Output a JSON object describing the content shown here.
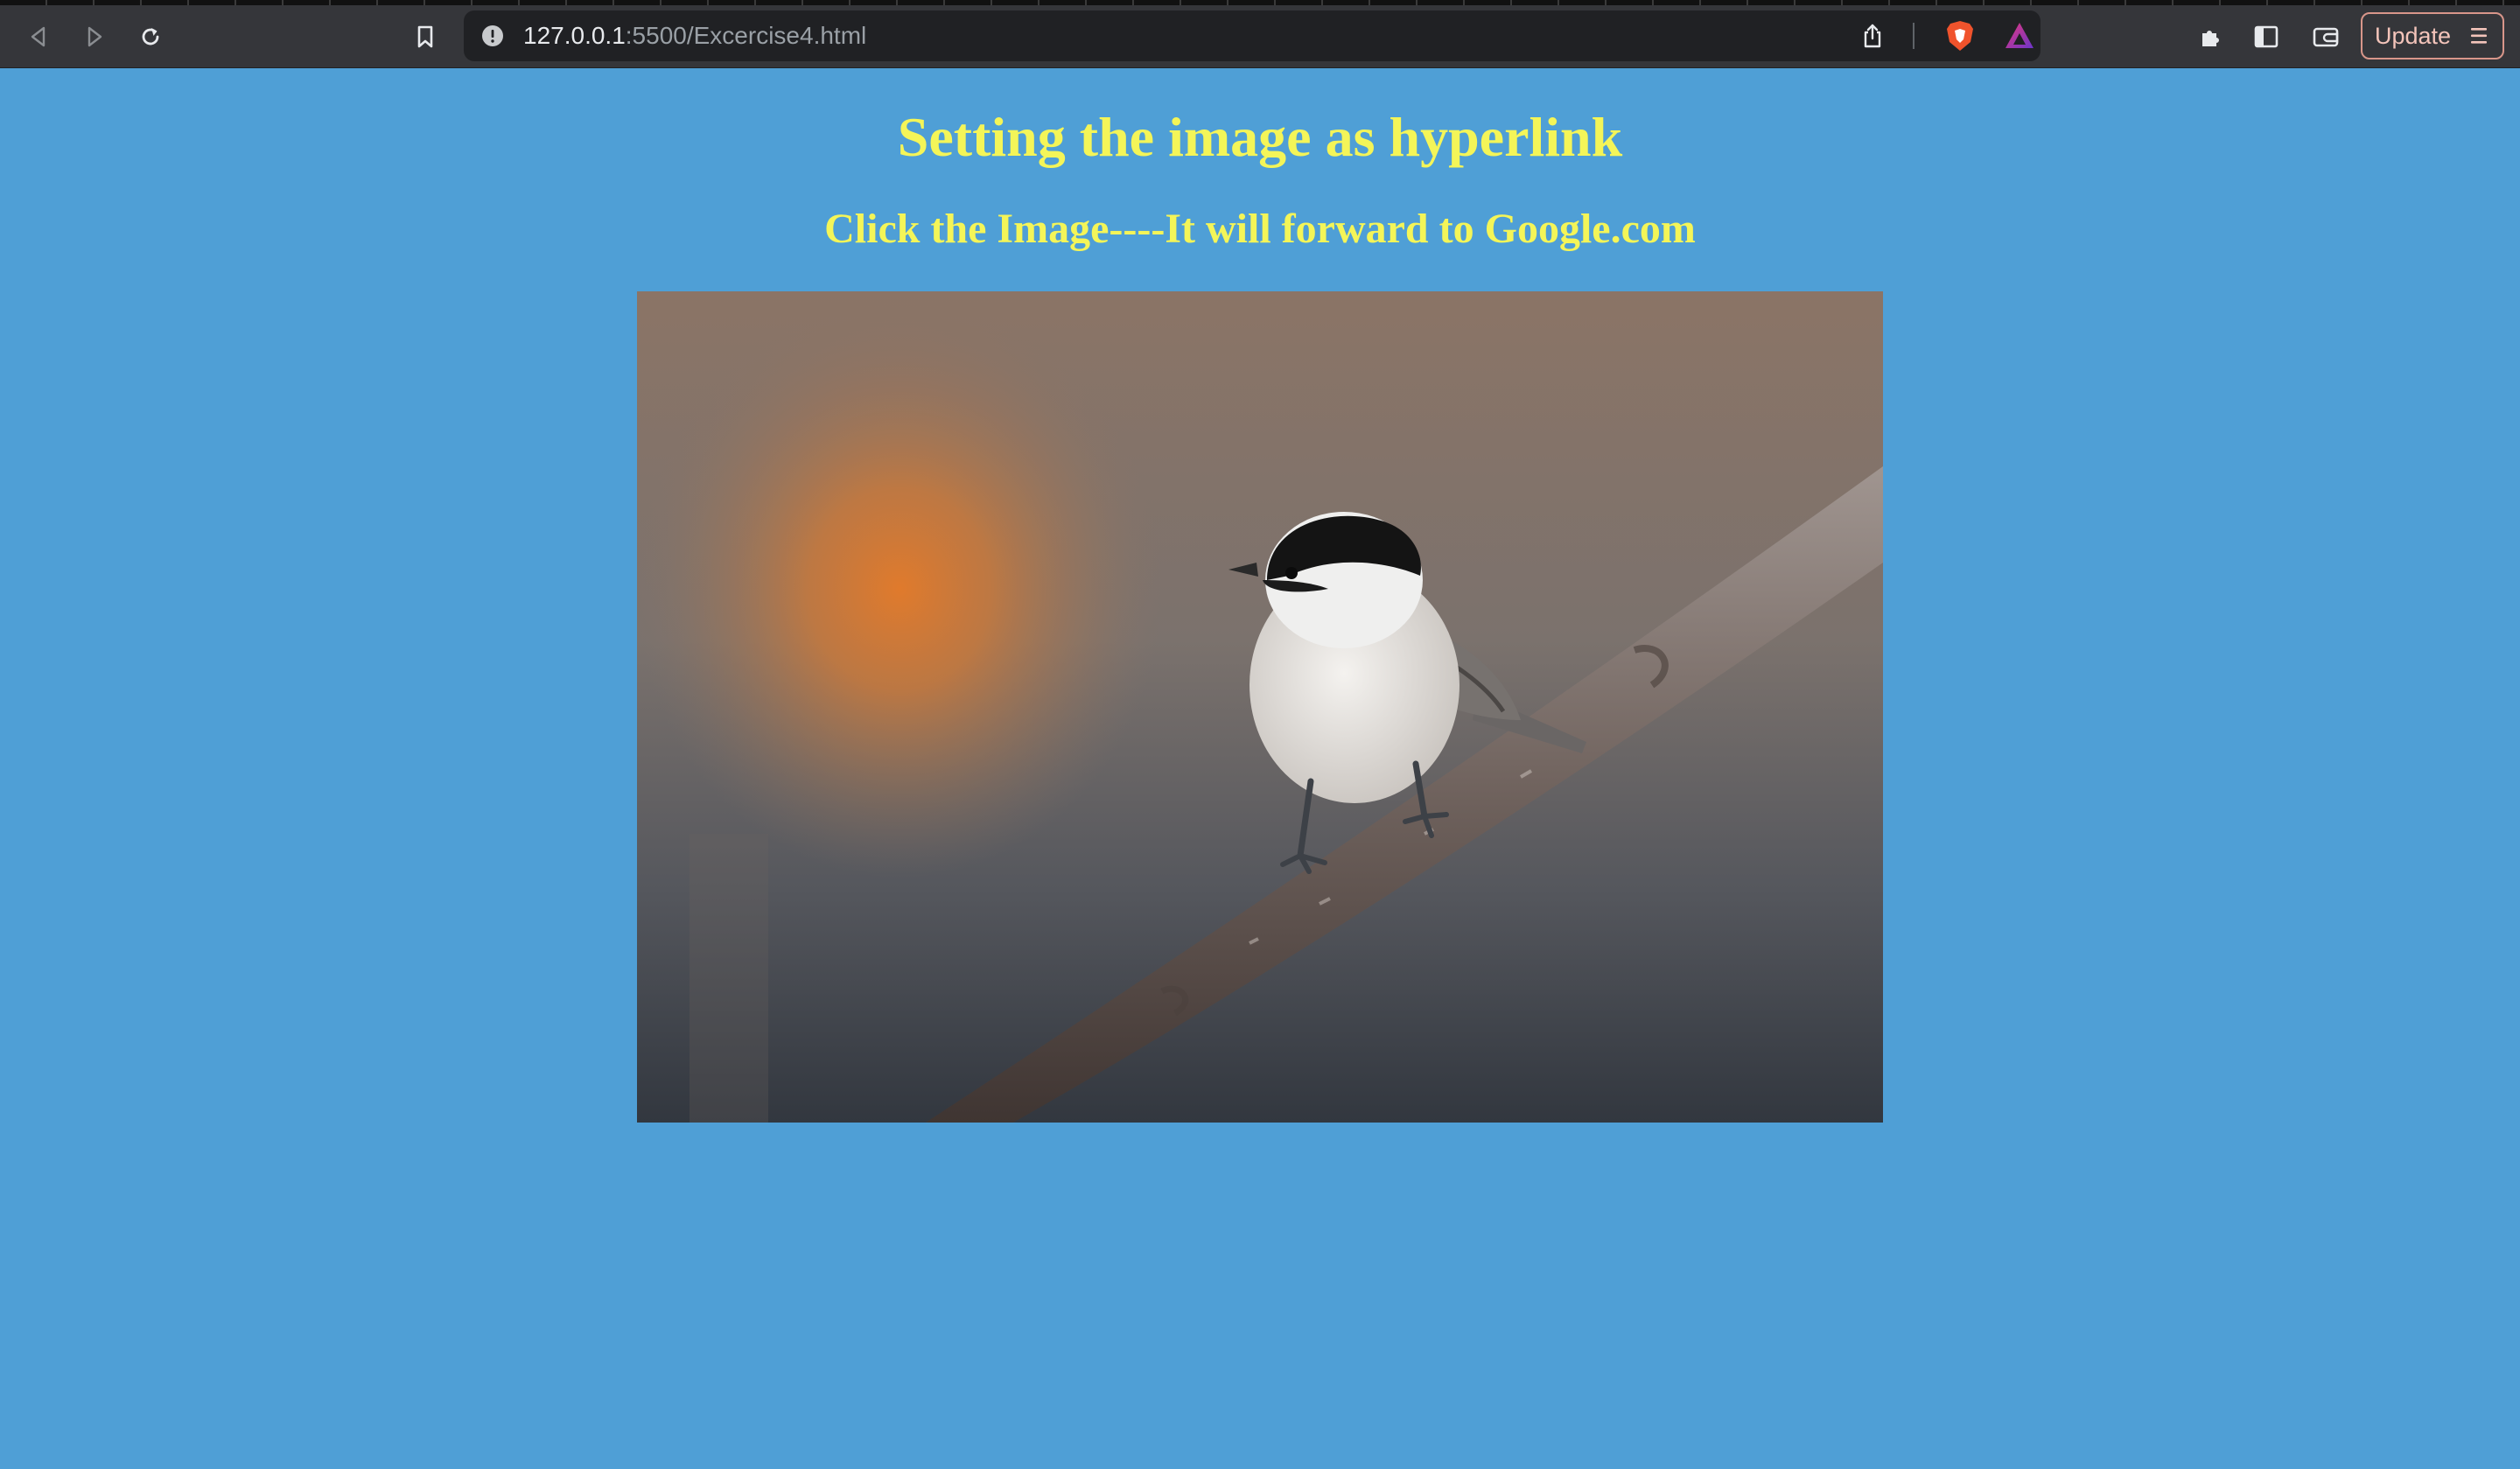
{
  "browser": {
    "url_host": "127.0.0.1",
    "url_path": ":5500/Excercise4.html",
    "update_label": "Update",
    "icons": [
      "back-icon",
      "forward-icon",
      "reload-icon",
      "bookmark-icon",
      "site-info-icon",
      "share-icon",
      "brave-shield-icon",
      "brave-rewards-icon",
      "extensions-icon",
      "sidebar-icon",
      "wallet-icon",
      "menu-icon"
    ]
  },
  "page": {
    "heading": "Setting the image as hyperlink",
    "subheading": "Click the Image----It will forward to Google.com",
    "image_alt": "bird",
    "background_color": "#4f9fd6",
    "text_color": "#f4f558"
  }
}
